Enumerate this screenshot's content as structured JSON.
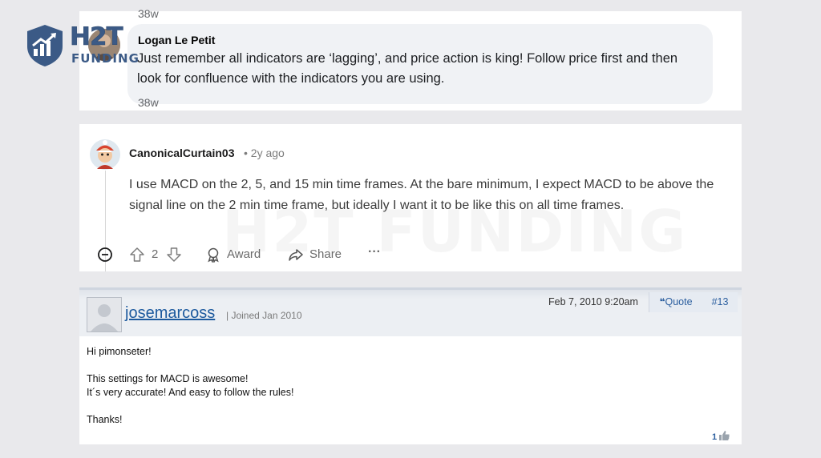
{
  "logo": {
    "brand_top": "H2T",
    "brand_bottom": "FUNDING",
    "colors": {
      "primary": "#3b5a86"
    }
  },
  "comment_facebook": {
    "top_timestamp": "38w",
    "author": "Logan Le Petit",
    "text": "Just remember all indicators are ‘lagging’, and price action is king! Follow price first and then look for confluence with the indicators you are using.",
    "timestamp": "38w",
    "avatar": "user-photo"
  },
  "comment_reddit": {
    "username": "CanonicalCurtain03",
    "separator": "•",
    "age": "2y ago",
    "text": "I use MACD on the 2, 5, and 15 min time frames. At the bare minimum, I expect MACD to be above the signal line on the 2 min time frame, but ideally I want it to be like this on all time frames.",
    "vote_count": "2",
    "award_label": "Award",
    "share_label": "Share",
    "more_label": "···",
    "watermark": "H2T FUNDING",
    "icons": [
      "collapse-icon",
      "upvote-icon",
      "downvote-icon",
      "award-icon",
      "share-icon",
      "more-icon"
    ]
  },
  "forum_post": {
    "username": "josemarcoss",
    "joined": "| Joined Jan 2010",
    "date": "Feb 7, 2010 9:20am",
    "quote_label": "Quote",
    "post_number": "#13",
    "lines": {
      "greeting": "Hi pimonseter!",
      "line1": "This settings for MACD is awesome!",
      "line2": "It´s very accurate! And easy to follow the rules!",
      "thanks": "Thanks!"
    },
    "likes": "1",
    "colors": {
      "link": "#1d5a9e",
      "header_bg": "#eceff3"
    }
  }
}
